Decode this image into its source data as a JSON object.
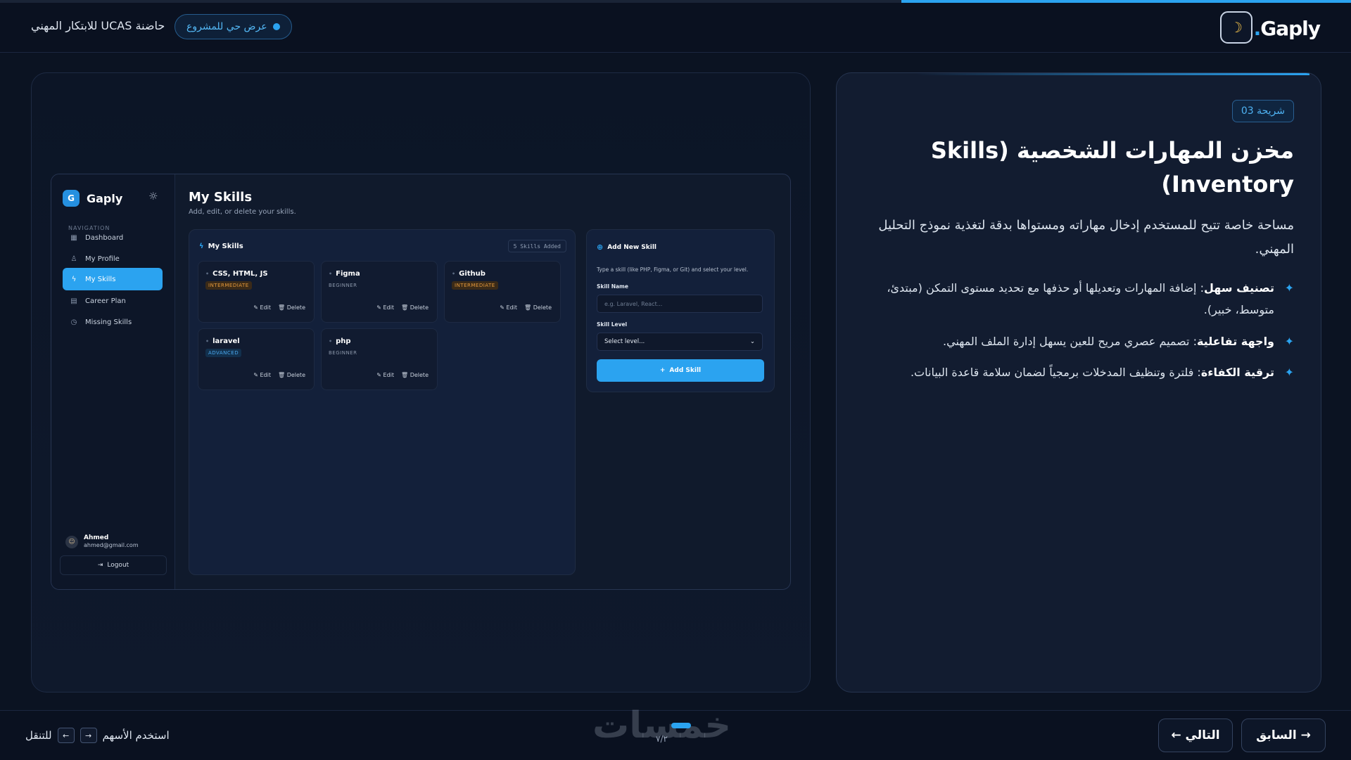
{
  "header": {
    "logo_text": "Gaply",
    "logo_dot": ".",
    "theme_icon": "moon-icon",
    "live_label": "عرض حي للمشروع",
    "incubator": "حاضنة UCAS للابتكار المهني",
    "progress": 0.333
  },
  "slide": {
    "badge": "شريحة 03",
    "title": "مخزن المهارات الشخصية (Skills Inventory)",
    "description": "مساحة خاصة تتيح للمستخدم إدخال مهاراته ومستواها بدقة لتغذية نموذج التحليل المهني.",
    "features": [
      {
        "bold": "تصنيف سهل",
        "text": ": إضافة المهارات وتعديلها أو حذفها مع تحديد مستوى التمكن (مبتدئ، متوسط، خبير)."
      },
      {
        "bold": "واجهة تفاعلية",
        "text": ": تصميم عصري مريح للعين يسهل إدارة الملف المهني."
      },
      {
        "bold": "ترقية الكفاءة",
        "text": ": فلترة وتنظيف المدخلات برمجياً لضمان سلامة قاعدة البيانات."
      }
    ]
  },
  "app": {
    "brand": "Gaply",
    "brand_initial": "G",
    "nav_label": "NAVIGATION",
    "nav": [
      {
        "label": "Dashboard",
        "icon": "grid-icon"
      },
      {
        "label": "My Profile",
        "icon": "user-icon"
      },
      {
        "label": "My Skills",
        "icon": "bolt-icon"
      },
      {
        "label": "Career Plan",
        "icon": "calendar-icon"
      },
      {
        "label": "Missing Skills",
        "icon": "clock-icon"
      }
    ],
    "user_name": "Ahmed",
    "user_email": "ahmed@gmail.com",
    "logout": "Logout",
    "title": "My Skills",
    "subtitle": "Add, edit, or delete your skills.",
    "panel_title": "My Skills",
    "skills_count": "5 Skills Added",
    "edit_label": "Edit",
    "delete_label": "Delete",
    "skills": [
      {
        "name": "CSS, HTML, JS",
        "level": "INTERMEDIATE"
      },
      {
        "name": "Figma",
        "level": "BEGINNER"
      },
      {
        "name": "Github",
        "level": "INTERMEDIATE"
      },
      {
        "name": "laravel",
        "level": "ADVANCED"
      },
      {
        "name": "php",
        "level": "BEGINNER"
      }
    ],
    "add": {
      "title": "Add New Skill",
      "hint": "Type a skill (like PHP, Figma, or Git) and select your level.",
      "name_label": "Skill Name",
      "name_placeholder": "e.g. Laravel, React...",
      "level_label": "Skill Level",
      "level_value": "Select level...",
      "button": "Add Skill"
    }
  },
  "footer": {
    "prev": "→ السابق",
    "next": "التالي ←",
    "hint_prefix": "استخدم الأسهم",
    "hint_suffix": "للتنقل",
    "key_right": "→",
    "key_left": "←",
    "page": "٧/٢",
    "watermark": "خمسات"
  },
  "colors": {
    "accent": "#2ba3f0",
    "bg": "#0b1322"
  }
}
